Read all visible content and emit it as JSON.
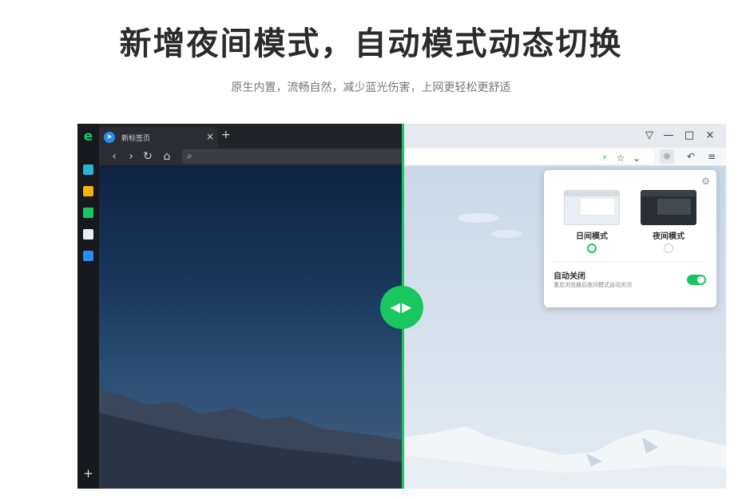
{
  "headline": "新增夜间模式，自动模式动态切换",
  "subline": "原生内置，流畅自然，减少蓝光伤害，上网更轻松更舒适",
  "browser": {
    "sidebar": {
      "logo": "e",
      "add_label": "+"
    },
    "tab": {
      "title": "新标签页",
      "close": "×",
      "new_tab": "+"
    },
    "nav": {
      "back": "‹",
      "forward": "›",
      "reload": "↻",
      "home": "⌂",
      "search_icon": "⌕"
    },
    "window_controls": {
      "shirt": "▽",
      "minimize": "—",
      "maximize": "□",
      "close": "×"
    },
    "toolbar_right": {
      "bolt": "⚡",
      "star": "☆",
      "chevron": "⌄",
      "theme": "☼",
      "undo": "↶",
      "menu": "≡"
    }
  },
  "popup": {
    "gear_icon": "⚙",
    "day_mode_label": "日间模式",
    "night_mode_label": "夜间模式",
    "selected_mode": "日间模式",
    "auto_close_title": "自动关闭",
    "auto_close_desc": "重启浏览器后夜间模式自动关闭",
    "auto_close_enabled": true
  },
  "compare_handle": "◀▶",
  "colors": {
    "accent": "#18c760",
    "dark_sky_top": "#0f2242",
    "light_sky": "#d6e1ec"
  }
}
